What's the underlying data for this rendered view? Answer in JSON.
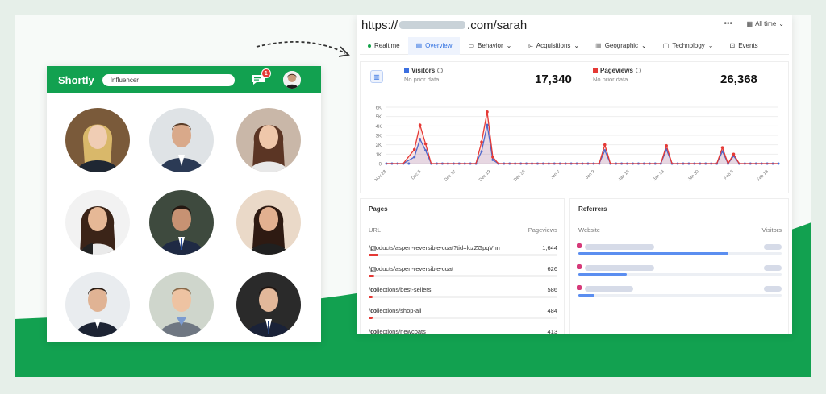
{
  "shortly": {
    "brand": "Shortly",
    "search_value": "Influencer",
    "notification_count": "1"
  },
  "analytics": {
    "url_prefix": "https://",
    "url_suffix": ".com/sarah",
    "range": "All time",
    "tabs": [
      {
        "label": "Realtime"
      },
      {
        "label": "Overview"
      },
      {
        "label": "Behavior"
      },
      {
        "label": "Acquisitions"
      },
      {
        "label": "Geographic"
      },
      {
        "label": "Technology"
      },
      {
        "label": "Events"
      }
    ],
    "visitors": {
      "label": "Visitors",
      "sub": "No prior data",
      "value": "17,340"
    },
    "pageviews": {
      "label": "Pageviews",
      "sub": "No prior data",
      "value": "26,368"
    }
  },
  "chart_data": {
    "type": "line",
    "x_ticks": [
      "Nov 28",
      "Dec 5",
      "Dec 12",
      "Dec 19",
      "Dec 26",
      "Jan 2",
      "Jan 9",
      "Jan 16",
      "Jan 23",
      "Jan 30",
      "Feb 6",
      "Feb 13"
    ],
    "y_ticks": [
      "0",
      "1K",
      "2K",
      "3K",
      "4K",
      "5K",
      "6K"
    ],
    "ylim": [
      0,
      6000
    ],
    "series": [
      {
        "name": "Visitors",
        "color": "#3b6fe0",
        "points": [
          [
            0,
            0
          ],
          [
            3,
            0
          ],
          [
            5,
            700
          ],
          [
            6,
            2600
          ],
          [
            7,
            1400
          ],
          [
            8,
            0
          ],
          [
            16,
            0
          ],
          [
            17,
            1300
          ],
          [
            18,
            4100
          ],
          [
            19,
            400
          ],
          [
            20,
            0
          ],
          [
            38,
            0
          ],
          [
            39,
            1400
          ],
          [
            40,
            0
          ],
          [
            49,
            0
          ],
          [
            50,
            1500
          ],
          [
            51,
            0
          ],
          [
            59,
            0
          ],
          [
            60,
            1300
          ],
          [
            61,
            0
          ],
          [
            62,
            800
          ],
          [
            63,
            0
          ],
          [
            70,
            0
          ]
        ]
      },
      {
        "name": "Pageviews",
        "color": "#e53935",
        "points": [
          [
            0,
            0
          ],
          [
            3,
            0
          ],
          [
            5,
            1500
          ],
          [
            6,
            4100
          ],
          [
            7,
            2100
          ],
          [
            8,
            0
          ],
          [
            16,
            0
          ],
          [
            17,
            2300
          ],
          [
            18,
            5500
          ],
          [
            19,
            700
          ],
          [
            20,
            0
          ],
          [
            38,
            0
          ],
          [
            39,
            2000
          ],
          [
            40,
            0
          ],
          [
            49,
            0
          ],
          [
            50,
            1900
          ],
          [
            51,
            0
          ],
          [
            59,
            0
          ],
          [
            60,
            1700
          ],
          [
            61,
            0
          ],
          [
            62,
            1000
          ],
          [
            63,
            0
          ],
          [
            70,
            0
          ]
        ]
      }
    ]
  },
  "pages": {
    "title": "Pages",
    "col_url": "URL",
    "col_value": "Pageviews",
    "rows": [
      {
        "url": "/products/aspen-reversible-coat?tid=lczZGpqVhn",
        "value": "1,644",
        "frac": 0.05
      },
      {
        "url": "/products/aspen-reversible-coat",
        "value": "626",
        "frac": 0.03
      },
      {
        "url": "/collections/best-sellers",
        "value": "586",
        "frac": 0.02
      },
      {
        "url": "/collections/shop-all",
        "value": "484",
        "frac": 0.02
      },
      {
        "url": "/collections/newcoats",
        "value": "413",
        "frac": 0.02
      }
    ]
  },
  "referrers": {
    "title": "Referrers",
    "col_site": "Website",
    "col_value": "Visitors",
    "rows": [
      {
        "frac": 0.74
      },
      {
        "frac": 0.24
      },
      {
        "frac": 0.08
      }
    ]
  },
  "colors": {
    "brand_green": "#12a150",
    "visitors": "#3b6fe0",
    "pageviews": "#e53935"
  }
}
